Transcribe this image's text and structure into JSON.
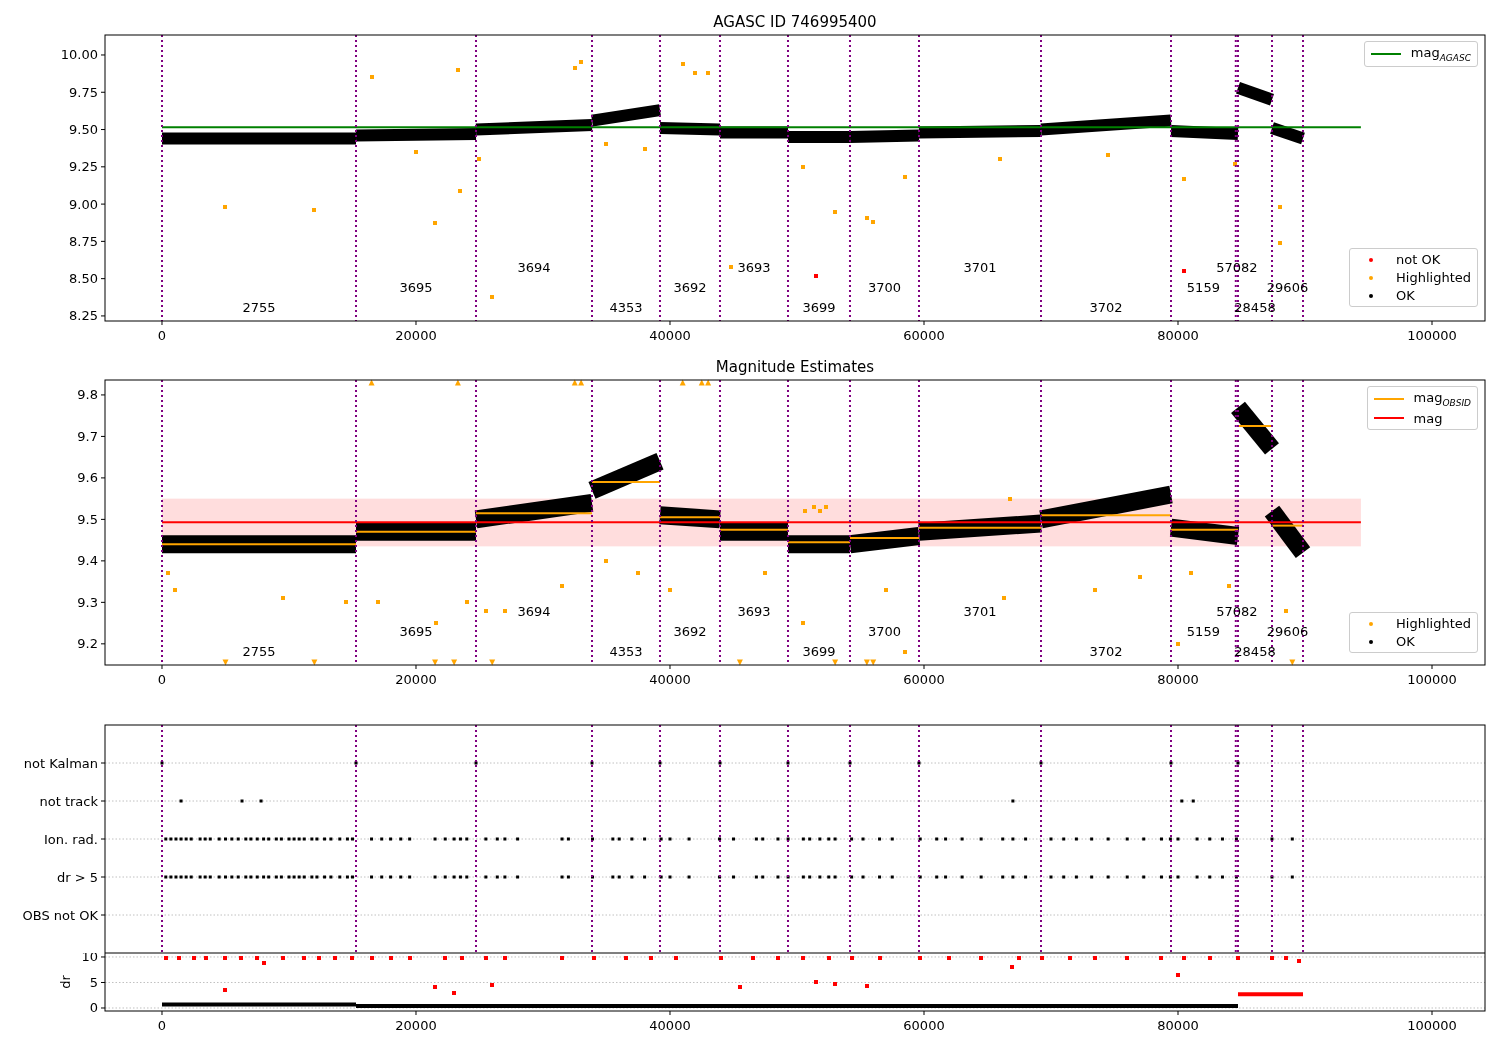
{
  "charts": [
    {
      "chart_data": {
        "type": "scatter",
        "title": "AGASC ID 746995400",
        "xlim": [
          -4488,
          104173
        ],
        "ylim": [
          8.216,
          10.134
        ],
        "xticks": [
          {
            "value": 0,
            "label": "0"
          },
          {
            "value": 20000,
            "label": "20000"
          },
          {
            "value": 40000,
            "label": "40000"
          },
          {
            "value": 60000,
            "label": "60000"
          },
          {
            "value": 80000,
            "label": "80000"
          },
          {
            "value": 100000,
            "label": "100000"
          }
        ],
        "yticks": [
          {
            "value": 8.25,
            "label": "8.25"
          },
          {
            "value": 8.5,
            "label": "8.50"
          },
          {
            "value": 8.75,
            "label": "8.75"
          },
          {
            "value": 9.0,
            "label": "9.00"
          },
          {
            "value": 9.25,
            "label": "9.25"
          },
          {
            "value": 9.5,
            "label": "9.50"
          },
          {
            "value": 9.75,
            "label": "9.75"
          },
          {
            "value": 10.0,
            "label": "10.00"
          }
        ],
        "x": [
          0,
          15276,
          5000,
          15276,
          24724,
          12000,
          24724,
          33858,
          16500,
          33858,
          39213,
          20000,
          39213,
          43937,
          21500,
          43937,
          49291,
          23300,
          49291,
          54173,
          23500,
          54173,
          59606,
          25000,
          59606,
          69213,
          26000,
          69213,
          79449,
          32500,
          79449,
          84724,
          33000,
          84724,
          87402,
          35000,
          87402,
          89843,
          38000,
          41000,
          42000,
          43000,
          44800,
          50500,
          53000,
          55500,
          56000,
          58500,
          66000,
          74500,
          80500,
          84500,
          88000,
          88000,
          51500,
          80500,
          0,
          94400
        ],
        "series": [
          {
            "name": "OK",
            "type": "line",
            "color": "#000000",
            "values": [
              9.44,
              9.44,
              null,
              9.46,
              9.47,
              null,
              9.5,
              9.53,
              null,
              9.56,
              9.63,
              null,
              9.51,
              9.5,
              null,
              9.48,
              9.48,
              null,
              9.45,
              9.45,
              null,
              9.45,
              9.46,
              null,
              9.48,
              9.49,
              null,
              9.5,
              9.56,
              null,
              9.49,
              9.47,
              null,
              9.78,
              9.7,
              null,
              9.51,
              9.44,
              null,
              null,
              null,
              null,
              null,
              null,
              null,
              null,
              null,
              null,
              null,
              null,
              null,
              null,
              null,
              null,
              null,
              null,
              null,
              null
            ]
          },
          {
            "name": "Highlighted",
            "type": "scatter",
            "color": "#ffa500",
            "values": [
              null,
              null,
              8.98,
              null,
              null,
              8.96,
              null,
              null,
              9.85,
              null,
              null,
              9.35,
              null,
              null,
              8.87,
              null,
              null,
              9.9,
              null,
              null,
              9.09,
              null,
              null,
              9.3,
              null,
              null,
              8.38,
              null,
              null,
              9.91,
              null,
              null,
              9.95,
              null,
              null,
              9.4,
              null,
              null,
              9.37,
              9.94,
              9.88,
              9.88,
              8.58,
              9.25,
              8.95,
              8.91,
              8.88,
              9.18,
              9.3,
              9.33,
              9.17,
              9.27,
              8.74,
              8.98,
              null,
              null,
              null,
              null
            ]
          },
          {
            "name": "not OK",
            "type": "scatter",
            "color": "#ff0000",
            "values": [
              null,
              null,
              null,
              null,
              null,
              null,
              null,
              null,
              null,
              null,
              null,
              null,
              null,
              null,
              null,
              null,
              null,
              null,
              null,
              null,
              null,
              null,
              null,
              null,
              null,
              null,
              null,
              null,
              null,
              null,
              null,
              null,
              null,
              null,
              null,
              null,
              null,
              null,
              null,
              null,
              null,
              null,
              null,
              null,
              null,
              null,
              null,
              null,
              null,
              null,
              null,
              null,
              null,
              null,
              8.52,
              8.55,
              null,
              null
            ]
          },
          {
            "name": "mag$_{AGASC}$",
            "type": "line",
            "color": "#008000",
            "values": [
              null,
              null,
              null,
              null,
              null,
              null,
              null,
              null,
              null,
              null,
              null,
              null,
              null,
              null,
              null,
              null,
              null,
              null,
              null,
              null,
              null,
              null,
              null,
              null,
              null,
              null,
              null,
              null,
              null,
              null,
              null,
              null,
              null,
              null,
              null,
              null,
              null,
              null,
              null,
              null,
              null,
              null,
              null,
              null,
              null,
              null,
              null,
              null,
              null,
              null,
              null,
              null,
              null,
              null,
              null,
              null,
              9.515,
              9.515
            ]
          }
        ],
        "ref_lines": [
          {
            "axis": "x",
            "value": 0
          },
          {
            "axis": "x",
            "value": 15276
          },
          {
            "axis": "x",
            "value": 24724
          },
          {
            "axis": "x",
            "value": 33858
          },
          {
            "axis": "x",
            "value": 39213
          },
          {
            "axis": "x",
            "value": 43937
          },
          {
            "axis": "x",
            "value": 49291
          },
          {
            "axis": "x",
            "value": 54173
          },
          {
            "axis": "x",
            "value": 59606
          },
          {
            "axis": "x",
            "value": 69213
          },
          {
            "axis": "x",
            "value": 79449
          },
          {
            "axis": "x",
            "value": 84550
          },
          {
            "axis": "x",
            "value": 84724
          },
          {
            "axis": "x",
            "value": 87402
          },
          {
            "axis": "x",
            "value": 89843
          }
        ],
        "annotations": [
          "2755",
          "3695",
          "3694",
          "4353",
          "3692",
          "3693",
          "3699",
          "3700",
          "3701",
          "3702",
          "5159",
          "57082",
          "28458",
          "29606"
        ]
      }
    },
    {
      "chart_data": {
        "type": "scatter",
        "title": "Magnitude Estimates",
        "xlim": [
          -4488,
          104173
        ],
        "ylim": [
          9.149,
          9.836
        ],
        "xticks": [
          {
            "value": 0,
            "label": "0"
          },
          {
            "value": 20000,
            "label": "20000"
          },
          {
            "value": 40000,
            "label": "40000"
          },
          {
            "value": 60000,
            "label": "60000"
          },
          {
            "value": 80000,
            "label": "80000"
          },
          {
            "value": 100000,
            "label": "100000"
          }
        ],
        "yticks": [
          {
            "value": 9.2,
            "label": "9.2"
          },
          {
            "value": 9.3,
            "label": "9.3"
          },
          {
            "value": 9.4,
            "label": "9.4"
          },
          {
            "value": 9.5,
            "label": "9.5"
          },
          {
            "value": 9.6,
            "label": "9.6"
          },
          {
            "value": 9.7,
            "label": "9.7"
          },
          {
            "value": 9.8,
            "label": "9.8"
          }
        ],
        "x": [
          0,
          15276,
          500,
          15276,
          24724,
          1000,
          24724,
          33858,
          5000,
          33858,
          39213,
          9500,
          39213,
          43937,
          12000,
          43937,
          49291,
          14500,
          49291,
          54173,
          16500,
          54173,
          59606,
          17000,
          59606,
          69213,
          21500,
          69213,
          79449,
          21600,
          79449,
          84724,
          23000,
          84724,
          87402,
          23300,
          87402,
          89843,
          24000,
          25500,
          26000,
          27000,
          31500,
          32500,
          33000,
          35000,
          37500,
          40000,
          41000,
          42500,
          43000,
          45500,
          47500,
          50500,
          50600,
          51300,
          51800,
          52300,
          53000,
          55500,
          56000,
          57000,
          58500,
          66300,
          66800,
          73500,
          77000,
          80000,
          81000,
          84000,
          88500,
          89000,
          0,
          94400
        ],
        "series": [
          {
            "name": "OK",
            "type": "line",
            "color": "#000000",
            "values": [
              9.44,
              9.44,
              null,
              9.47,
              9.47,
              null,
              9.5,
              9.54,
              null,
              9.57,
              9.64,
              null,
              9.51,
              9.5,
              null,
              9.47,
              9.47,
              null,
              9.44,
              9.44,
              null,
              9.44,
              9.46,
              null,
              9.47,
              9.49,
              null,
              9.5,
              9.56,
              null,
              9.48,
              9.46,
              null,
              9.77,
              9.67,
              null,
              9.52,
              9.42,
              null,
              null,
              null,
              null,
              null,
              null,
              null,
              null,
              null,
              null,
              null,
              null,
              null,
              null,
              null,
              null,
              null,
              null,
              null,
              null,
              null,
              null,
              null,
              null,
              null,
              null,
              null,
              null,
              null,
              null,
              null,
              null,
              null,
              null,
              null,
              null
            ]
          },
          {
            "name": "Highlighted",
            "type": "scatter",
            "color": "#ffa500",
            "values": [
              null,
              null,
              9.37,
              null,
              null,
              9.33,
              null,
              null,
              9.155,
              null,
              null,
              9.31,
              null,
              null,
              9.155,
              null,
              null,
              9.3,
              null,
              null,
              9.83,
              null,
              null,
              9.3,
              null,
              null,
              9.155,
              null,
              null,
              9.25,
              null,
              null,
              9.155,
              null,
              null,
              9.83,
              null,
              null,
              9.3,
              9.28,
              9.155,
              9.28,
              9.34,
              9.83,
              9.83,
              9.4,
              9.37,
              9.33,
              9.83,
              9.83,
              9.83,
              9.155,
              9.37,
              9.25,
              9.52,
              9.53,
              9.52,
              9.53,
              9.155,
              9.155,
              9.155,
              9.33,
              9.18,
              9.31,
              9.55,
              9.33,
              9.36,
              9.2,
              9.37,
              9.34,
              9.28,
              9.155,
              null,
              null
            ]
          },
          {
            "name": "mag$_{OBSID}$",
            "type": "line",
            "color": "#ffa500",
            "values": [
              9.44,
              9.44,
              null,
              9.47,
              9.47,
              null,
              9.515,
              9.515,
              null,
              9.59,
              9.59,
              null,
              9.505,
              9.505,
              null,
              9.475,
              9.475,
              null,
              9.445,
              9.445,
              null,
              9.455,
              9.455,
              null,
              9.48,
              9.48,
              null,
              9.51,
              9.51,
              null,
              9.475,
              9.475,
              null,
              9.725,
              9.725,
              null,
              9.485,
              9.485,
              null,
              null,
              null,
              null,
              null,
              null,
              null,
              null,
              null,
              null,
              null,
              null,
              null,
              null,
              null,
              null,
              null,
              null,
              null,
              null,
              null,
              null,
              null,
              null,
              null,
              null,
              null,
              null,
              null,
              null,
              null,
              null,
              null,
              null,
              null,
              null
            ]
          },
          {
            "name": "mag",
            "type": "line",
            "color": "#ff0000",
            "values": [
              null,
              null,
              null,
              null,
              null,
              null,
              null,
              null,
              null,
              null,
              null,
              null,
              null,
              null,
              null,
              null,
              null,
              null,
              null,
              null,
              null,
              null,
              null,
              null,
              null,
              null,
              null,
              null,
              null,
              null,
              null,
              null,
              null,
              null,
              null,
              null,
              null,
              null,
              null,
              null,
              null,
              null,
              null,
              null,
              null,
              null,
              null,
              null,
              null,
              null,
              null,
              null,
              null,
              null,
              null,
              null,
              null,
              null,
              null,
              null,
              null,
              null,
              null,
              null,
              null,
              null,
              null,
              null,
              null,
              null,
              null,
              null,
              9.493,
              9.493
            ]
          }
        ],
        "bands": [
          {
            "axis": "y",
            "from": 9.435,
            "to": 9.55,
            "color": "#ffdddd"
          }
        ],
        "ref_lines": [
          {
            "axis": "x",
            "value": 0
          },
          {
            "axis": "x",
            "value": 15276
          },
          {
            "axis": "x",
            "value": 24724
          },
          {
            "axis": "x",
            "value": 33858
          },
          {
            "axis": "x",
            "value": 39213
          },
          {
            "axis": "x",
            "value": 43937
          },
          {
            "axis": "x",
            "value": 49291
          },
          {
            "axis": "x",
            "value": 54173
          },
          {
            "axis": "x",
            "value": 59606
          },
          {
            "axis": "x",
            "value": 69213
          },
          {
            "axis": "x",
            "value": 79449
          },
          {
            "axis": "x",
            "value": 84550
          },
          {
            "axis": "x",
            "value": 84724
          },
          {
            "axis": "x",
            "value": 87402
          },
          {
            "axis": "x",
            "value": 89843
          }
        ],
        "annotations": [
          "2755",
          "3695",
          "3694",
          "4353",
          "3692",
          "3693",
          "3699",
          "3700",
          "3701",
          "3702",
          "5159",
          "57082",
          "28458",
          "29606"
        ]
      }
    },
    {
      "chart_data": {
        "type": "scatter",
        "ylabel": "dr",
        "grid": true,
        "xlim": [
          -4488,
          104173
        ],
        "ylim": [
          -0.59,
          10.78
        ],
        "xticks": [
          {
            "value": 0,
            "label": "0"
          },
          {
            "value": 20000,
            "label": "20000"
          },
          {
            "value": 40000,
            "label": "40000"
          },
          {
            "value": 60000,
            "label": "60000"
          },
          {
            "value": 80000,
            "label": "80000"
          },
          {
            "value": 100000,
            "label": "100000"
          }
        ],
        "yticks": [
          {
            "value": 0,
            "label": "0"
          },
          {
            "value": 5,
            "label": "5"
          },
          {
            "value": 10,
            "label": "10"
          }
        ],
        "x": [
          0,
          15276,
          300,
          15276,
          84724,
          84724,
          89843,
          1300,
          2500,
          3500,
          5000,
          6200,
          7500,
          8000,
          9500,
          11200,
          12400,
          13600,
          15000,
          16500,
          18000,
          19500,
          22300,
          23600,
          25500,
          27000,
          31500,
          34000,
          36500,
          38500,
          40500,
          44000,
          46500,
          48500,
          50500,
          52500,
          54300,
          56500,
          59700,
          62000,
          64500,
          67500,
          69300,
          71500,
          73500,
          76000,
          78700,
          80500,
          82500,
          84700,
          87400,
          88500,
          89500,
          5000,
          21500,
          23000,
          26000,
          45500,
          51500,
          53000,
          55500,
          66900,
          80000
        ],
        "series": [
          {
            "type": "line",
            "color": "#000000",
            "values": [
              0.7,
              0.7,
              null,
              0.4,
              0.4,
              null,
              null,
              null,
              null,
              null,
              null,
              null,
              null,
              null,
              null,
              null,
              null,
              null,
              null,
              null,
              null,
              null,
              null,
              null,
              null,
              null,
              null,
              null,
              null,
              null,
              null,
              null,
              null,
              null,
              null,
              null,
              null,
              null,
              null,
              null,
              null,
              null,
              null,
              null,
              null,
              null,
              null,
              null,
              null,
              null,
              null,
              null,
              null,
              null,
              null,
              null,
              null,
              null,
              null,
              null,
              null,
              null,
              null
            ]
          },
          {
            "type": "line",
            "color": "#ff0000",
            "values": [
              null,
              null,
              null,
              null,
              null,
              2.7,
              2.7,
              null,
              null,
              null,
              null,
              null,
              null,
              null,
              null,
              null,
              null,
              null,
              null,
              null,
              null,
              null,
              null,
              null,
              null,
              null,
              null,
              null,
              null,
              null,
              null,
              null,
              null,
              null,
              null,
              null,
              null,
              null,
              null,
              null,
              null,
              null,
              null,
              null,
              null,
              null,
              null,
              null,
              null,
              null,
              null,
              null,
              null,
              null,
              null,
              null,
              null,
              null,
              null,
              null,
              null,
              null,
              null
            ]
          },
          {
            "type": "scatter",
            "color": "#ff0000",
            "values": [
              null,
              null,
              9.8,
              null,
              null,
              null,
              null,
              9.8,
              9.8,
              9.8,
              9.8,
              9.8,
              9.8,
              8.8,
              9.8,
              9.8,
              9.8,
              9.8,
              9.8,
              9.8,
              9.8,
              9.8,
              9.8,
              9.8,
              9.8,
              9.8,
              9.8,
              9.8,
              9.8,
              9.8,
              9.8,
              9.8,
              9.8,
              9.8,
              9.8,
              9.8,
              9.8,
              9.8,
              9.8,
              9.8,
              9.8,
              9.8,
              9.8,
              9.8,
              9.8,
              9.8,
              9.8,
              9.8,
              9.8,
              9.8,
              9.8,
              9.8,
              9.3,
              3.5,
              4.2,
              3,
              4.5,
              4.2,
              5,
              4.7,
              4.4,
              8,
              6.5
            ]
          }
        ]
      }
    }
  ],
  "flags_panel": {
    "row_labels": [
      "not Kalman",
      "not track",
      "Ion. rad.",
      "dr > 5",
      "OBS not OK"
    ]
  }
}
